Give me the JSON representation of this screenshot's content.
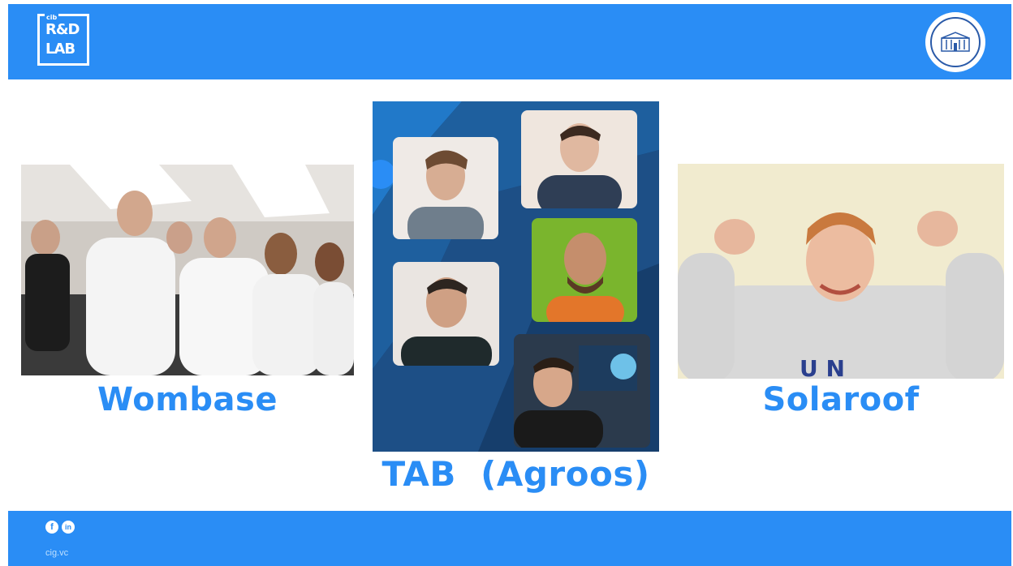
{
  "header": {
    "logo_line1": "R&D",
    "logo_line2": "LAB",
    "logo_small": "cib"
  },
  "teams": [
    {
      "name": "Wombase"
    },
    {
      "name": "TAB  (Agroos)"
    },
    {
      "name": "Solaroof"
    }
  ],
  "footer": {
    "facebook_glyph": "f",
    "linkedin_glyph": "in",
    "website": "cig.vc"
  },
  "colors": {
    "brand_blue": "#2a8df5"
  }
}
